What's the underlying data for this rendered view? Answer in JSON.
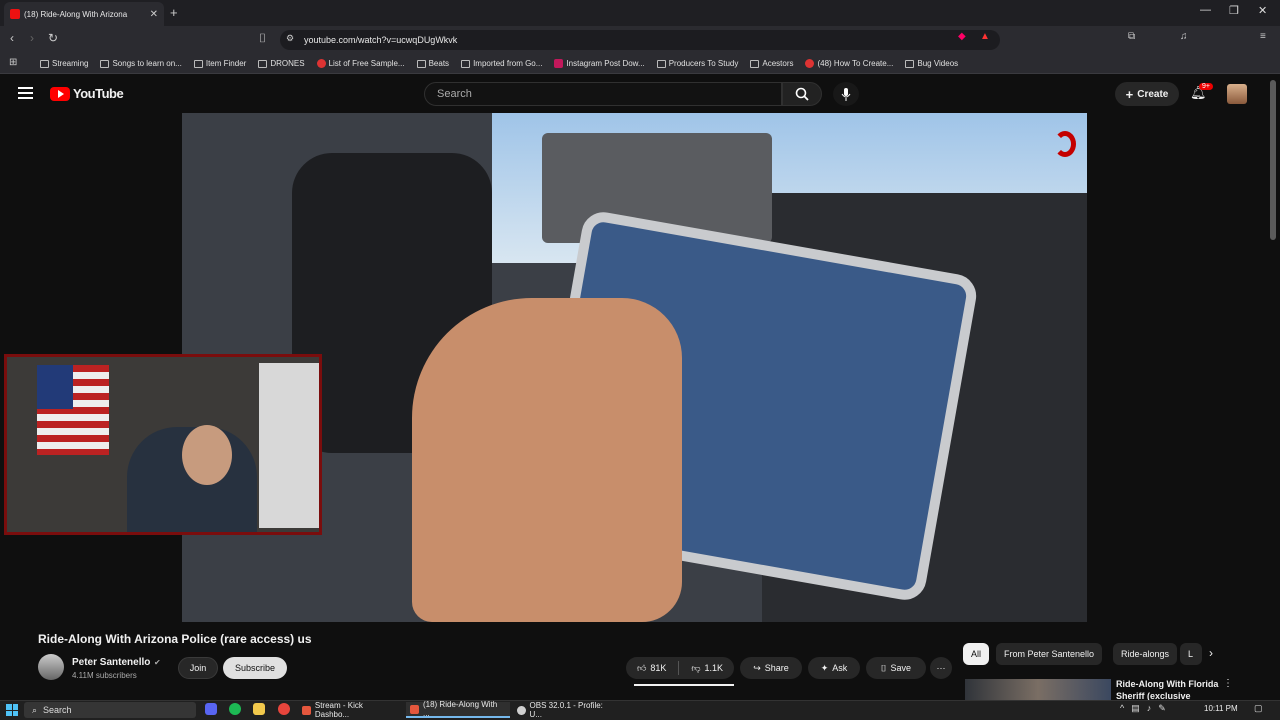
{
  "browser": {
    "tab_title": "(18) Ride-Along With Arizona",
    "url": "youtube.com/watch?v=ucwqDUgWkvk",
    "bookmarks": [
      {
        "label": "Streaming",
        "icon": "folder-icon"
      },
      {
        "label": "Songs to learn on...",
        "icon": "folder-icon"
      },
      {
        "label": "Item Finder",
        "icon": "folder-icon"
      },
      {
        "label": "DRONES",
        "icon": "folder-icon"
      },
      {
        "label": "List of Free Sample...",
        "icon": "red-favicon"
      },
      {
        "label": "Beats",
        "icon": "folder-icon"
      },
      {
        "label": "Imported from Go...",
        "icon": "folder-icon"
      },
      {
        "label": "Instagram Post Dow...",
        "icon": "instagram-favicon"
      },
      {
        "label": "Producers To Study",
        "icon": "folder-icon"
      },
      {
        "label": "Acestors",
        "icon": "folder-icon"
      },
      {
        "label": "(48) How To Create...",
        "icon": "youtube-favicon"
      },
      {
        "label": "Bug Videos",
        "icon": "folder-icon"
      }
    ]
  },
  "youtube": {
    "logo_text": "YouTube",
    "search_placeholder": "Search",
    "create_label": "Create",
    "notification_count": "9+"
  },
  "video": {
    "title": "Ride-Along With Arizona Police (rare access) us",
    "channel_name": "Peter Santenello",
    "subscribers": "4.11M subscribers",
    "join_label": "Join",
    "subscribe_label": "Subscribe",
    "likes": "81K",
    "dislikes": "1.1K",
    "share_label": "Share",
    "ask_label": "Ask",
    "save_label": "Save"
  },
  "chips": [
    "All",
    "From Peter Santenello",
    "Ride-alongs",
    "L"
  ],
  "recommended": {
    "title": "Ride-Along With Florida Sheriff (exclusive"
  },
  "taskbar": {
    "search_label": "Search",
    "apps": [
      {
        "label": "Stream - Kick Dashbo...",
        "color": "#e5573d"
      },
      {
        "label": "(18) Ride-Along With ...",
        "color": "#e5573d"
      },
      {
        "label": "OBS 32.0.1 - Profile: U...",
        "color": "#cfcfcf"
      }
    ],
    "clock": "10:11 PM"
  },
  "colors": {
    "youtube_red": "#ff0000",
    "background": "#0f0f0f",
    "webcam_border": "#7a0d0d"
  }
}
